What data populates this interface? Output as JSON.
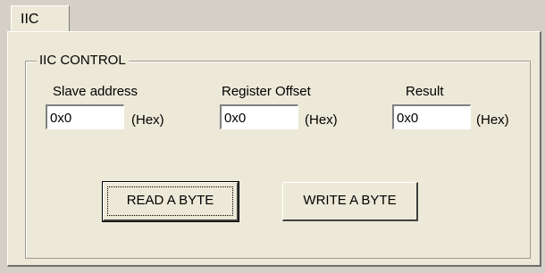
{
  "tab": {
    "label": "IIC"
  },
  "group": {
    "title": "IIC CONTROL"
  },
  "fields": [
    {
      "label": "Slave address",
      "value": "0x0",
      "unit": "(Hex)"
    },
    {
      "label": "Register Offset",
      "value": "0x0",
      "unit": "(Hex)"
    },
    {
      "label": "Result",
      "value": "0x0",
      "unit": "(Hex)"
    }
  ],
  "buttons": {
    "read": "READ A BYTE",
    "write": "WRITE A BYTE"
  }
}
